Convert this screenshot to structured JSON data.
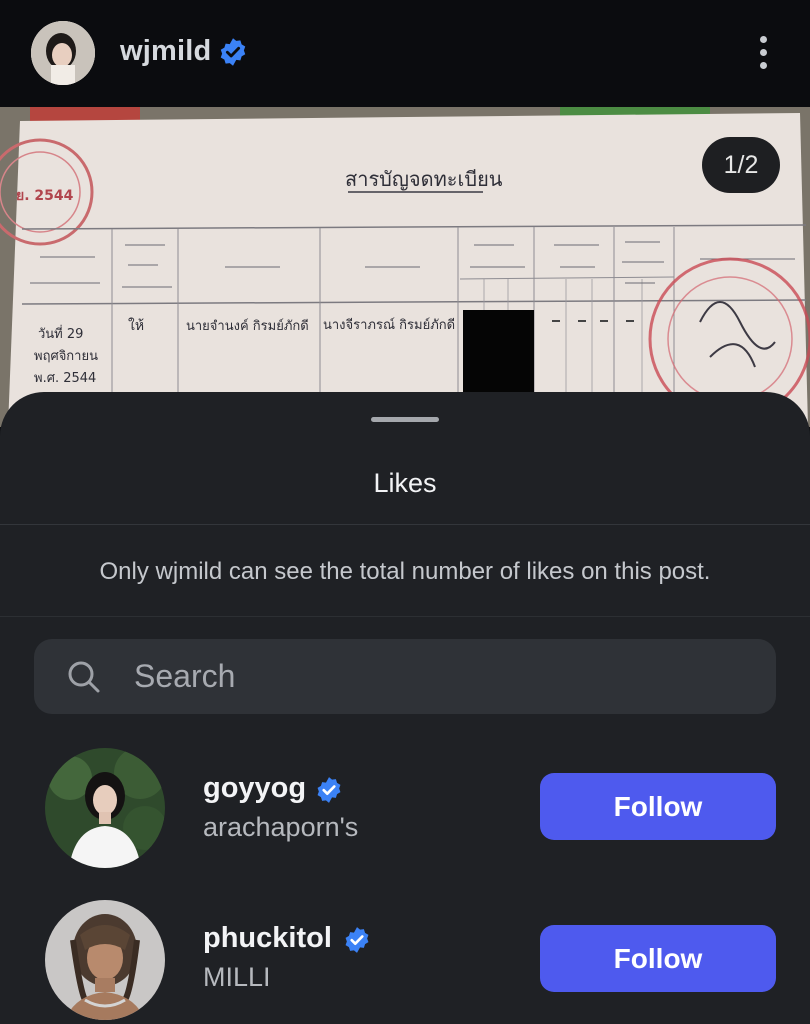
{
  "header": {
    "username": "wjmild",
    "verified": true,
    "more_icon": "more-vertical-icon"
  },
  "post": {
    "page_indicator": "1/2",
    "document_title": "สารบัญจดทะเบียน",
    "document_row_date": "วันที่ 29",
    "document_row_month": "พฤศจิกายน",
    "document_row_year": "พ.ศ. 2544",
    "document_row_type": "ให้",
    "document_giver": "นายจำนงค์ กิรมย์ภักดี",
    "document_receiver": "นางจีราภรณ์ กิรมย์ภักดี",
    "stamp_year": "ย. 2544"
  },
  "sheet": {
    "title": "Likes",
    "notice": "Only wjmild can see the total number of likes on this post.",
    "search": {
      "placeholder": "Search",
      "icon": "search-icon"
    },
    "users": [
      {
        "handle": "goyyog",
        "name": "arachaporn's",
        "verified": true,
        "button": "Follow"
      },
      {
        "handle": "phuckitol",
        "name": "MILLI",
        "verified": true,
        "button": "Follow"
      }
    ]
  },
  "colors": {
    "accent": "#4e5aee",
    "verified": "#3b82f6",
    "sheet_bg": "#1f2125"
  }
}
